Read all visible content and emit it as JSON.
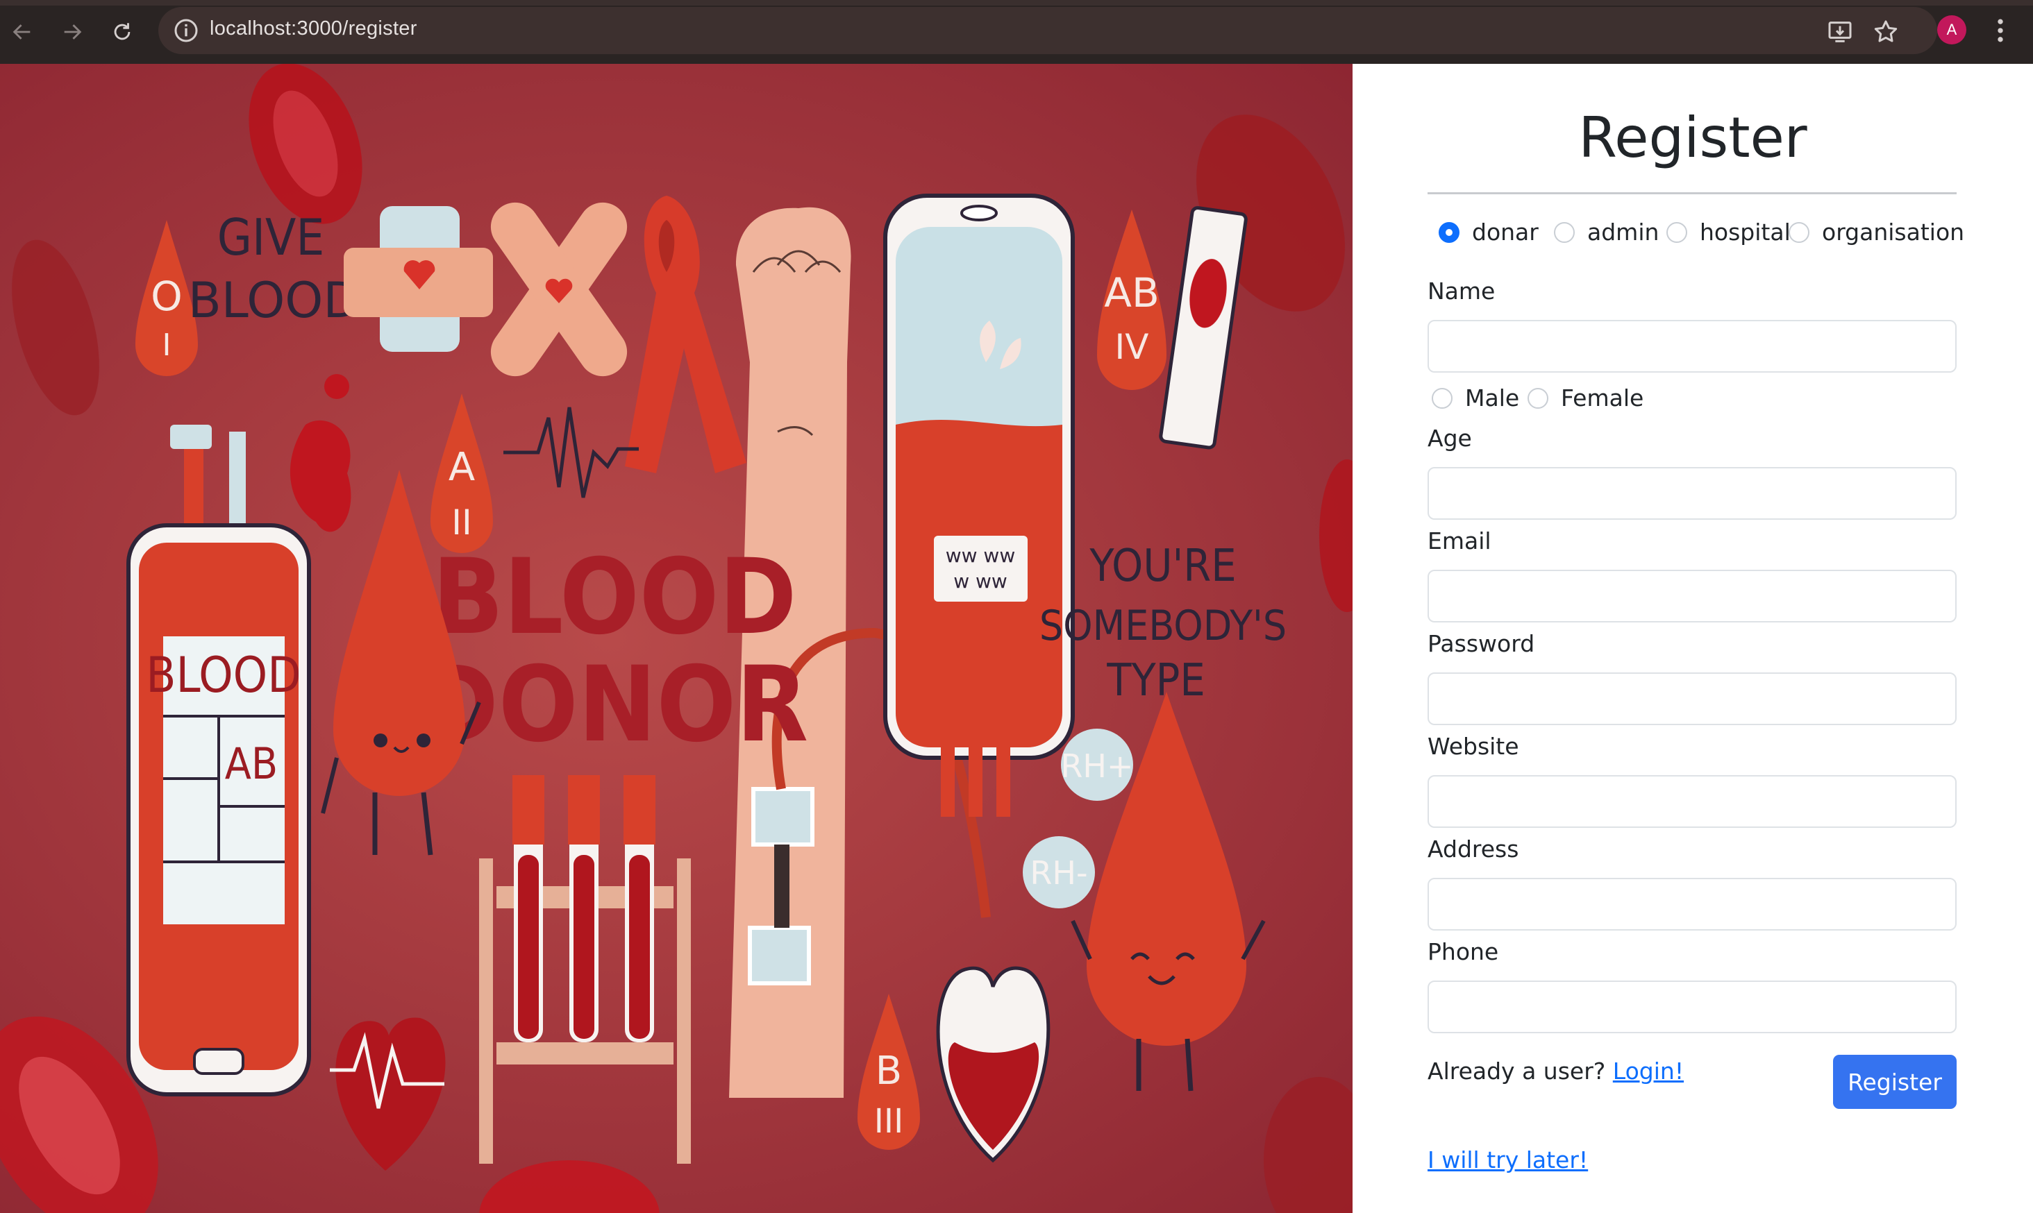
{
  "browser": {
    "url": "localhost:3000/register",
    "avatar_letter": "A"
  },
  "hero": {
    "texts": {
      "give": "GIVE",
      "blood_small": "BLOOD",
      "blood_big": "BLOOD",
      "donor": "DONOR",
      "bag_blood": "BLOOD",
      "bag_ab": "AB",
      "o": "O",
      "o_roman": "I",
      "a": "A",
      "a_roman": "II",
      "ab": "AB",
      "ab_roman": "IV",
      "b": "B",
      "b_roman": "III",
      "youre": "YOU'RE",
      "somebodys": "SOMEBODY'S",
      "type": "TYPE",
      "rh_pos": "RH+",
      "rh_neg": "RH-"
    }
  },
  "form": {
    "title": "Register",
    "roles": [
      {
        "label": "donar",
        "checked": true
      },
      {
        "label": "admin",
        "checked": false
      },
      {
        "label": "hospital",
        "checked": false
      },
      {
        "label": "organisation",
        "checked": false
      }
    ],
    "name_label": "Name",
    "genders": [
      {
        "label": "Male"
      },
      {
        "label": "Female"
      }
    ],
    "age_label": "Age",
    "email_label": "Email",
    "password_label": "Password",
    "website_label": "Website",
    "address_label": "Address",
    "phone_label": "Phone",
    "already_text": "Already a user?",
    "login_link": "Login!",
    "register_button": "Register",
    "later_link": "I will try later!"
  }
}
